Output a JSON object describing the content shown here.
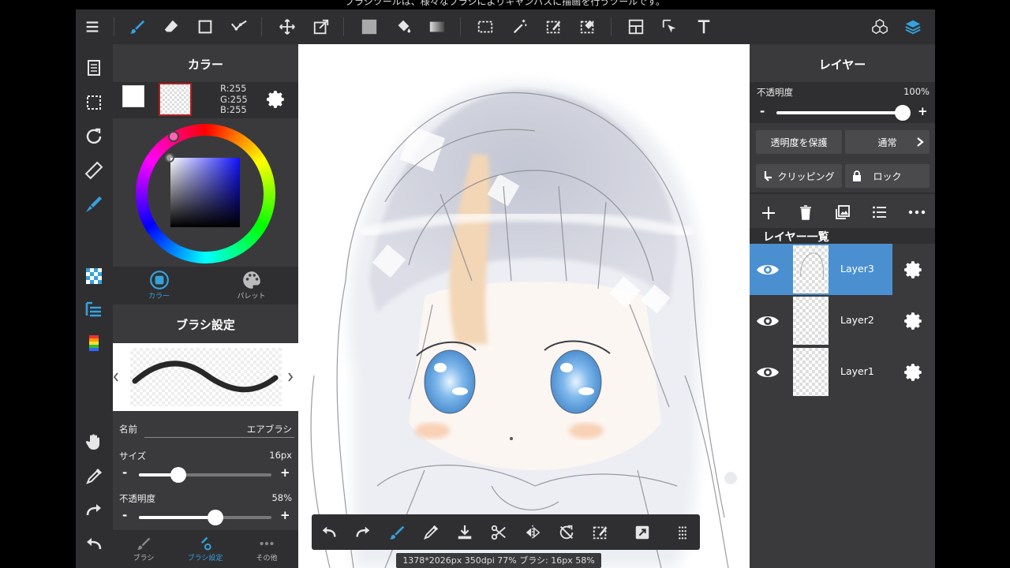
{
  "hint": "ブラシツールは、様々なブラシによりキャンバスに描画を行うツールです。",
  "color_panel": {
    "title": "カラー",
    "rgb": {
      "r": "R:255",
      "g": "G:255",
      "b": "B:255"
    },
    "tabs": [
      {
        "label": "カラー",
        "icon": "color-circle-icon",
        "active": true
      },
      {
        "label": "パレット",
        "icon": "palette-icon",
        "active": false
      }
    ]
  },
  "brush_panel": {
    "title": "ブラシ設定",
    "name_label": "名前",
    "name_value": "エアブラシ",
    "size_label": "サイズ",
    "size_value": "16px",
    "size_level": 0.3,
    "opacity_label": "不透明度",
    "opacity_value": "58%",
    "opacity_level": 0.58,
    "minus": "-",
    "plus": "+",
    "tabs": [
      {
        "label": "ブラシ",
        "icon": "brush-icon"
      },
      {
        "label": "ブラシ設定",
        "icon": "brush-settings-icon"
      },
      {
        "label": "その他",
        "icon": "more-icon"
      }
    ]
  },
  "layer_panel": {
    "title": "レイヤー",
    "opacity_label": "不透明度",
    "opacity_value": "100%",
    "opacity_level": 1.0,
    "minus": "-",
    "plus": "+",
    "protect_alpha": "透明度を保護",
    "blend_mode": "通常",
    "clipping": "クリッピング",
    "lock": "ロック",
    "list_title": "レイヤー一覧",
    "layers": [
      {
        "name": "Layer3",
        "selected": true
      },
      {
        "name": "Layer2",
        "selected": false
      },
      {
        "name": "Layer1",
        "selected": false
      }
    ]
  },
  "status": "1378*2026px 350dpi 77% ブラシ: 16px 58%",
  "colors": {
    "accent": "#34a3de",
    "selected_layer": "#4a90d0",
    "panel": "#3a3a3c",
    "toolbar": "#2f2f31"
  }
}
